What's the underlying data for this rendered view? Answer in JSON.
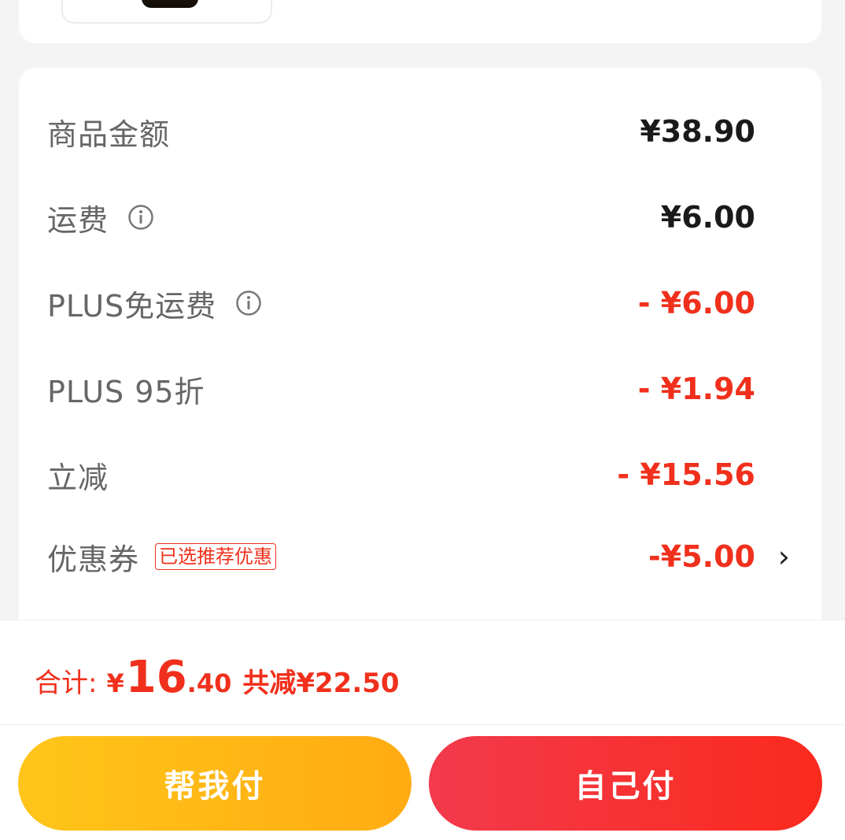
{
  "summary": {
    "subtotal": {
      "label": "商品金额",
      "value": "¥38.90"
    },
    "shipping": {
      "label": "运费",
      "value": "¥6.00",
      "icon": "info-icon"
    },
    "plus_free_shipping": {
      "label": "PLUS免运费",
      "value": "- ¥6.00",
      "icon": "info-icon"
    },
    "plus_discount": {
      "label": "PLUS 95折",
      "value": "- ¥1.94"
    },
    "instant_discount": {
      "label": "立减",
      "value": "- ¥15.56"
    },
    "coupon": {
      "label": "优惠券",
      "tag": "已选推荐优惠",
      "value": "-¥5.00",
      "chevron": "›"
    }
  },
  "total": {
    "label": "合计:",
    "currency": "¥",
    "integer": "16",
    "decimal": ".40",
    "saved": "共减¥22.50"
  },
  "buttons": {
    "help_pay": "帮我付",
    "self_pay": "自己付"
  },
  "colors": {
    "accent_red": "#f0301c",
    "help_button": "#ffb814",
    "self_button": "#f5303a"
  }
}
